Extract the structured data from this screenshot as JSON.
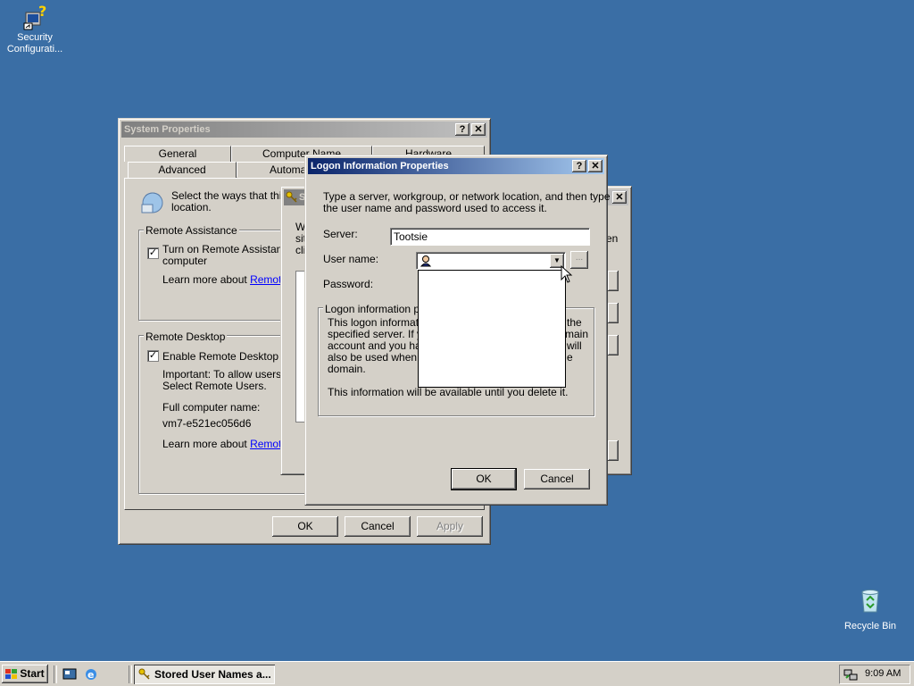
{
  "desktop": {
    "icons": [
      {
        "label_line1": "Security",
        "label_line2": "Configurati...",
        "icon": "security-config-icon"
      },
      {
        "label": "Recycle Bin",
        "icon": "recycle-bin-icon"
      }
    ]
  },
  "system_properties": {
    "title": "System Properties",
    "tabs_row1": [
      "General",
      "Computer Name",
      "Hardware"
    ],
    "tabs_row2": [
      "Advanced",
      "Automat"
    ],
    "intro": "Select the ways that this c",
    "intro2": "location.",
    "remote_assistance": {
      "group_label": "Remote Assistance",
      "checkbox_label1": "Turn on Remote Assistance",
      "checkbox_label2": "computer",
      "learn_text": "Learn more about ",
      "learn_link": "Remote A"
    },
    "remote_desktop": {
      "group_label": "Remote Desktop",
      "checkbox_label": "Enable Remote Desktop on",
      "important1": "Important: To allow users to",
      "important2": "Select Remote Users.",
      "computer_name_label": "Full computer name:",
      "computer_name": "vm7-e521ec056d6",
      "learn_text": "Learn more about ",
      "learn_link": "Remote D"
    },
    "buttons": {
      "ok": "OK",
      "cancel": "Cancel",
      "apply": "Apply"
    }
  },
  "stored_names": {
    "title": "S",
    "text1": "W",
    "text2": "sit",
    "text3": "cli",
    "right_text": "en"
  },
  "logon_dialog": {
    "title": "Logon Information Properties",
    "instructions1": "Type a server, workgroup, or network location, and then type",
    "instructions2": "the user name and password used to access it.",
    "server_label": "Server:",
    "server_value": "Tootsie",
    "username_label": "User name:",
    "username_value": "",
    "browse_label": "...",
    "password_label": "Password:",
    "info_group_label": "Logon information pro",
    "info_lines_left": [
      "This logon information",
      "specified server. If yo",
      "account and you hav",
      "also be used when yo",
      "domain."
    ],
    "info_lines_right": [
      "the",
      "main",
      "will",
      "e"
    ],
    "info_footer": "This information will be available until you delete it.",
    "buttons": {
      "ok": "OK",
      "cancel": "Cancel"
    }
  },
  "taskbar": {
    "start_label": "Start",
    "task_label": "Stored User Names a...",
    "clock": "9:09 AM"
  }
}
